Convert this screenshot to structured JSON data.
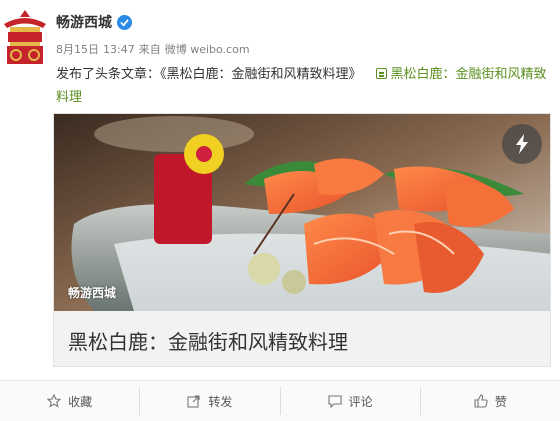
{
  "post": {
    "author": "畅游西城",
    "date": "8月15日",
    "time": "13:47",
    "source_prefix": "来自",
    "source": "微博 weibo.com",
    "text_prefix": "发布了头条文章：",
    "article_quote": "《黑松白鹿：金融街和风精致料理》",
    "article_link": "黑松白鹿：金融街和风精致料理"
  },
  "card": {
    "watermark": "畅游西城",
    "title": "黑松白鹿：金融街和风精致料理"
  },
  "actions": [
    {
      "label": "收藏",
      "icon": "star-icon"
    },
    {
      "label": "转发",
      "icon": "share-icon"
    },
    {
      "label": "评论",
      "icon": "comment-icon"
    },
    {
      "label": "赞",
      "icon": "thumbs-up-icon"
    }
  ],
  "colors": {
    "link": "#5b8f1f",
    "verified": "#2a8ae6",
    "avatar_red": "#c4242a",
    "avatar_gold": "#e6b84a"
  }
}
